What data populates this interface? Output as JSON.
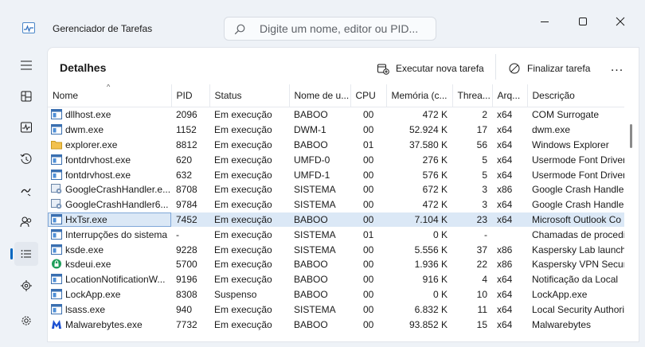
{
  "app": {
    "title": "Gerenciador de Tarefas"
  },
  "search": {
    "placeholder": "Digite um nome, editor ou PID..."
  },
  "sidebar": {
    "items": [
      {
        "icon": "hamburger-menu-icon"
      },
      {
        "icon": "processes-icon"
      },
      {
        "icon": "performance-icon"
      },
      {
        "icon": "app-history-icon"
      },
      {
        "icon": "startup-apps-icon"
      },
      {
        "icon": "users-icon"
      },
      {
        "icon": "details-icon",
        "active": true
      },
      {
        "icon": "services-icon"
      },
      {
        "icon": "settings-icon"
      }
    ]
  },
  "panel": {
    "title": "Detalhes",
    "run_task_label": "Executar nova tarefa",
    "end_task_label": "Finalizar tarefa",
    "more_label": "..."
  },
  "table": {
    "columns": [
      "Nome",
      "PID",
      "Status",
      "Nome de u...",
      "CPU",
      "Memória (c...",
      "Threa...",
      "Arq...",
      "Descrição"
    ],
    "rows": [
      {
        "icon": "window-app-icon",
        "name": "dllhost.exe",
        "pid": "2096",
        "status": "Em execução",
        "user": "BABOO",
        "cpu": "00",
        "mem": "472 K",
        "threads": "2",
        "arch": "x64",
        "desc": "COM Surrogate"
      },
      {
        "icon": "window-app-icon",
        "name": "dwm.exe",
        "pid": "1152",
        "status": "Em execução",
        "user": "DWM-1",
        "cpu": "00",
        "mem": "52.924 K",
        "threads": "17",
        "arch": "x64",
        "desc": "dwm.exe"
      },
      {
        "icon": "folder-icon",
        "name": "explorer.exe",
        "pid": "8812",
        "status": "Em execução",
        "user": "BABOO",
        "cpu": "01",
        "mem": "37.580 K",
        "threads": "56",
        "arch": "x64",
        "desc": "Windows Explorer"
      },
      {
        "icon": "window-app-icon",
        "name": "fontdrvhost.exe",
        "pid": "620",
        "status": "Em execução",
        "user": "UMFD-0",
        "cpu": "00",
        "mem": "276 K",
        "threads": "5",
        "arch": "x64",
        "desc": "Usermode Font Driver"
      },
      {
        "icon": "window-app-icon",
        "name": "fontdrvhost.exe",
        "pid": "632",
        "status": "Em execução",
        "user": "UMFD-1",
        "cpu": "00",
        "mem": "576 K",
        "threads": "5",
        "arch": "x64",
        "desc": "Usermode Font Driver"
      },
      {
        "icon": "crash-handler-icon",
        "name": "GoogleCrashHandler.e...",
        "pid": "8708",
        "status": "Em execução",
        "user": "SISTEMA",
        "cpu": "00",
        "mem": "672 K",
        "threads": "3",
        "arch": "x86",
        "desc": "Google Crash Handler"
      },
      {
        "icon": "crash-handler-icon",
        "name": "GoogleCrashHandler6...",
        "pid": "9784",
        "status": "Em execução",
        "user": "SISTEMA",
        "cpu": "00",
        "mem": "472 K",
        "threads": "3",
        "arch": "x64",
        "desc": "Google Crash Handler"
      },
      {
        "icon": "window-app-icon",
        "name": "HxTsr.exe",
        "pid": "7452",
        "status": "Em execução",
        "user": "BABOO",
        "cpu": "00",
        "mem": "7.104 K",
        "threads": "23",
        "arch": "x64",
        "desc": "Microsoft Outlook Co",
        "selected": true
      },
      {
        "icon": "window-app-icon",
        "name": "Interrupções do sistema",
        "pid": "-",
        "status": "Em execução",
        "user": "SISTEMA",
        "cpu": "01",
        "mem": "0 K",
        "threads": "-",
        "arch": "",
        "desc": "Chamadas de procedin"
      },
      {
        "icon": "window-app-icon",
        "name": "ksde.exe",
        "pid": "9228",
        "status": "Em execução",
        "user": "SISTEMA",
        "cpu": "00",
        "mem": "5.556 K",
        "threads": "37",
        "arch": "x86",
        "desc": "Kaspersky Lab launche"
      },
      {
        "icon": "kaspersky-vpn-icon",
        "name": "ksdeui.exe",
        "pid": "5700",
        "status": "Em execução",
        "user": "BABOO",
        "cpu": "00",
        "mem": "1.936 K",
        "threads": "22",
        "arch": "x86",
        "desc": "Kaspersky VPN Secure"
      },
      {
        "icon": "window-app-icon",
        "name": "LocationNotificationW...",
        "pid": "9196",
        "status": "Em execução",
        "user": "BABOO",
        "cpu": "00",
        "mem": "916 K",
        "threads": "4",
        "arch": "x64",
        "desc": "Notificação da Local"
      },
      {
        "icon": "window-app-icon",
        "name": "LockApp.exe",
        "pid": "8308",
        "status": "Suspenso",
        "user": "BABOO",
        "cpu": "00",
        "mem": "0 K",
        "threads": "10",
        "arch": "x64",
        "desc": "LockApp.exe"
      },
      {
        "icon": "window-app-icon",
        "name": "lsass.exe",
        "pid": "940",
        "status": "Em execução",
        "user": "SISTEMA",
        "cpu": "00",
        "mem": "6.832 K",
        "threads": "11",
        "arch": "x64",
        "desc": "Local Security Authori"
      },
      {
        "icon": "malwarebytes-icon",
        "name": "Malwarebytes.exe",
        "pid": "7732",
        "status": "Em execução",
        "user": "BABOO",
        "cpu": "00",
        "mem": "93.852 K",
        "threads": "15",
        "arch": "x64",
        "desc": "Malwarebytes"
      }
    ]
  },
  "colors": {
    "accent": "#0067c0",
    "selected_row": "#dbe8f6",
    "background": "#eef2f7"
  }
}
